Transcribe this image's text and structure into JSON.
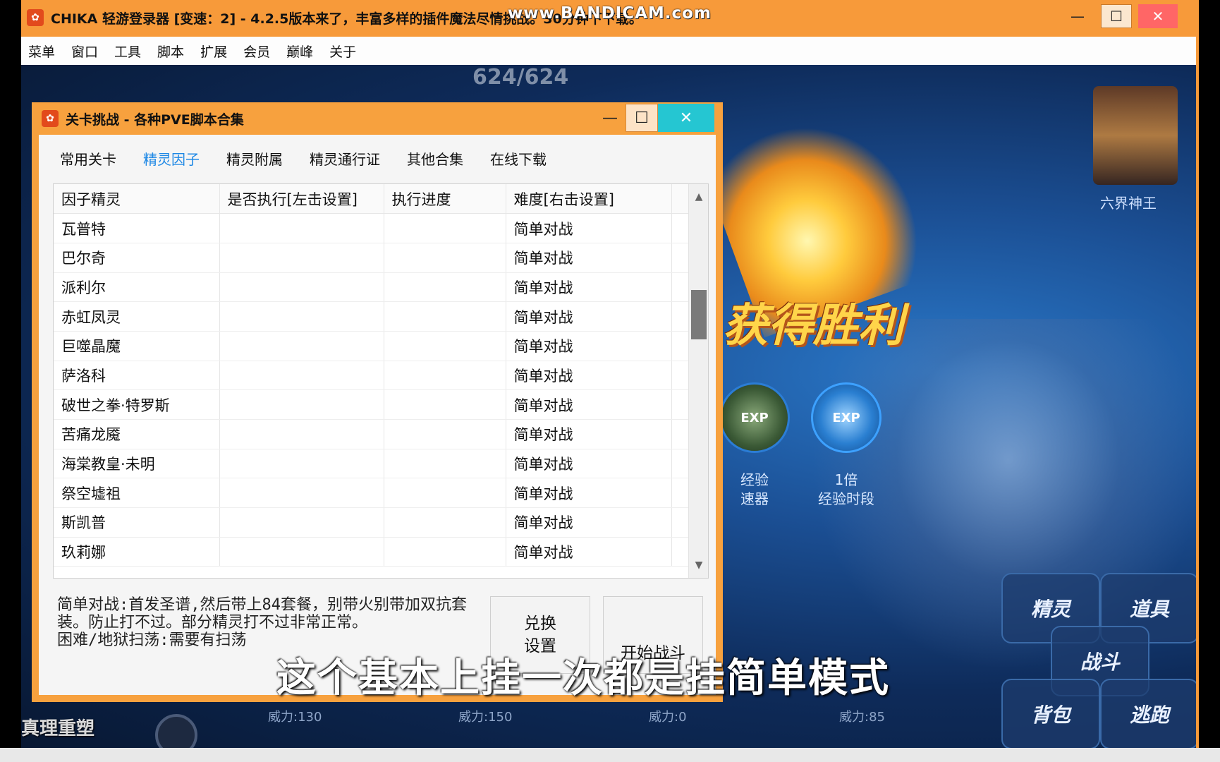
{
  "outer_window": {
    "title": "CHIKA 轻游登录器 [变速：2] - 4.2.5版本来了，丰富多样的插件魔法尽情挑战。30分钟下下载。",
    "app_icon": "cartoon-app-icon",
    "minimize": "—",
    "maximize": "☐",
    "close": "✕"
  },
  "watermark": "www.BANDICAM.com",
  "menubar": {
    "items": [
      "菜单",
      "窗口",
      "工具",
      "脚本",
      "扩展",
      "会员",
      "巅峰",
      "关于"
    ]
  },
  "game": {
    "hp": "624/624",
    "victory_text": "获得胜利",
    "player_name": "六界神王",
    "exp_boost_label": "经验\n速器",
    "exp_time_label": "1倍\n经验时段",
    "exp_badge": "EXP",
    "power_labels": [
      "威力:130",
      "威力:150",
      "威力:0",
      "威力:85"
    ],
    "buttons": [
      "精灵",
      "道具",
      "战斗",
      "逃跑",
      "背包"
    ],
    "logo_text": "真理重塑"
  },
  "dialog": {
    "title": "关卡挑战 - 各种PVE脚本合集",
    "minimize": "—",
    "maximize": "☐",
    "close": "✕",
    "tabs": [
      "常用关卡",
      "精灵因子",
      "精灵附属",
      "精灵通行证",
      "其他合集",
      "在线下载"
    ],
    "active_tab": 1,
    "table": {
      "headers": [
        "因子精灵",
        "是否执行[左击设置]",
        "执行进度",
        "难度[右击设置]"
      ],
      "rows": [
        {
          "name": "瓦普特",
          "run": "",
          "progress": "",
          "difficulty": "简单对战"
        },
        {
          "name": "巴尔奇",
          "run": "",
          "progress": "",
          "difficulty": "简单对战"
        },
        {
          "name": "派利尔",
          "run": "",
          "progress": "",
          "difficulty": "简单对战"
        },
        {
          "name": "赤虹凤灵",
          "run": "",
          "progress": "",
          "difficulty": "简单对战"
        },
        {
          "name": "巨噬晶魔",
          "run": "",
          "progress": "",
          "difficulty": "简单对战"
        },
        {
          "name": "萨洛科",
          "run": "",
          "progress": "",
          "difficulty": "简单对战"
        },
        {
          "name": "破世之拳·特罗斯",
          "run": "",
          "progress": "",
          "difficulty": "简单对战"
        },
        {
          "name": "苦痛龙魇",
          "run": "",
          "progress": "",
          "difficulty": "简单对战"
        },
        {
          "name": "海棠教皇·未明",
          "run": "",
          "progress": "",
          "difficulty": "简单对战"
        },
        {
          "name": "祭空墟祖",
          "run": "",
          "progress": "",
          "difficulty": "简单对战"
        },
        {
          "name": "斯凯普",
          "run": "",
          "progress": "",
          "difficulty": "简单对战"
        },
        {
          "name": "玖莉娜",
          "run": "",
          "progress": "",
          "difficulty": "简单对战"
        }
      ]
    },
    "notes_line1": "简单对战:首发圣谱,然后带上84套餐，别带火别带加双抗套装。防止打不过。部分精灵打不过非常正常。",
    "notes_line2": "困难/地狱扫荡:需要有扫荡",
    "exchange_button": "兑换\n设置",
    "start_button": "开始战斗"
  },
  "subtitle": "这个基本上挂一次都是挂简单模式"
}
